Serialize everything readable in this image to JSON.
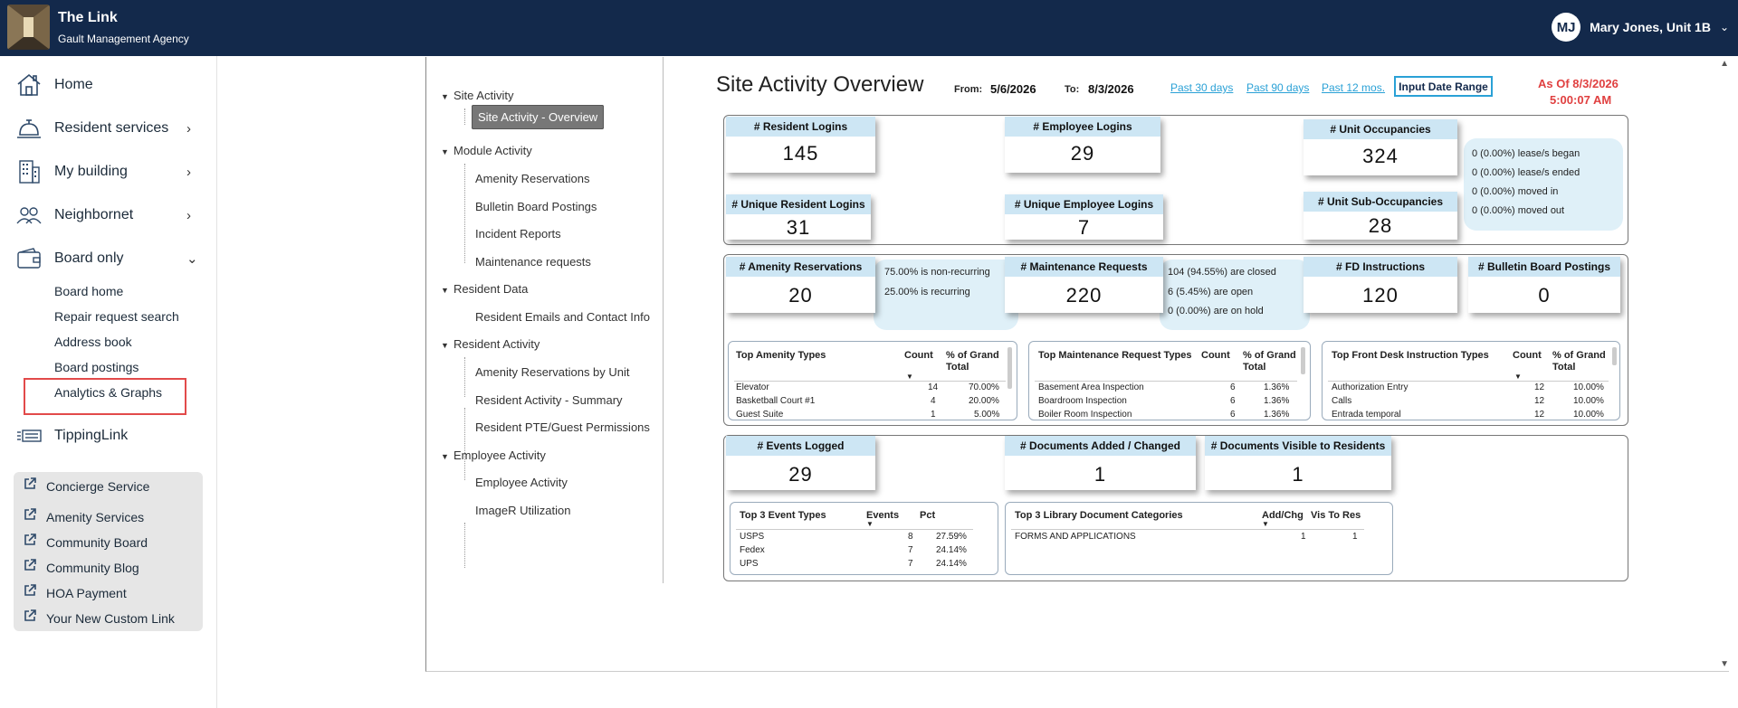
{
  "header": {
    "app_title": "The Link",
    "app_subtitle": "Gault Management Agency",
    "user_initials": "MJ",
    "user_name": "Mary Jones, Unit 1B"
  },
  "sidebar": {
    "items": [
      {
        "label": "Home",
        "icon": "home-icon"
      },
      {
        "label": "Resident services",
        "icon": "bell-icon"
      },
      {
        "label": "My building",
        "icon": "building-icon"
      },
      {
        "label": "Neighbornet",
        "icon": "people-icon"
      },
      {
        "label": "Board only",
        "icon": "wallet-icon"
      },
      {
        "label": "TippingLink",
        "icon": "list-icon"
      }
    ],
    "board_sub": [
      "Board home",
      "Repair request search",
      "Address book",
      "Board postings",
      "Analytics & Graphs"
    ],
    "external_links": [
      "Concierge Service",
      "Amenity Services",
      "Community Board",
      "Community Blog",
      "HOA Payment",
      "Your New Custom Link"
    ]
  },
  "tree": {
    "categories": [
      {
        "label": "Site Activity",
        "items": [
          "Site Activity - Overview"
        ]
      },
      {
        "label": "Module Activity",
        "items": [
          "Amenity Reservations",
          "Bulletin Board Postings",
          "Incident Reports",
          "Maintenance requests"
        ]
      },
      {
        "label": "Resident Data",
        "items": [
          "Resident Emails and Contact Info"
        ]
      },
      {
        "label": "Resident Activity",
        "items": [
          "Amenity Reservations by Unit",
          "Resident Activity - Summary",
          "Resident PTE/Guest Permissions"
        ]
      },
      {
        "label": "Employee Activity",
        "items": [
          "Employee Activity",
          "ImageR Utilization"
        ]
      }
    ]
  },
  "dashboard": {
    "title": "Site Activity Overview",
    "from_label": "From:",
    "from_value": "5/6/2026",
    "to_label": "To:",
    "to_value": "8/3/2026",
    "links": [
      "Past 30 days",
      "Past 90 days",
      "Past 12 mos."
    ],
    "input_range": "Input Date Range",
    "as_of_date": "As Of 8/3/2026",
    "as_of_time": "5:00:07 AM",
    "kpis": {
      "resident_logins": {
        "label": "# Resident Logins",
        "value": "145"
      },
      "employee_logins": {
        "label": "# Employee Logins",
        "value": "29"
      },
      "unit_occupancies": {
        "label": "# Unit Occupancies",
        "value": "324"
      },
      "unique_resident_logins": {
        "label": "# Unique Resident Logins",
        "value": "31"
      },
      "unique_employee_logins": {
        "label": "# Unique Employee Logins",
        "value": "7"
      },
      "unit_sub_occupancies": {
        "label": "# Unit Sub-Occupancies",
        "value": "28"
      },
      "amenity_reservations": {
        "label": "# Amenity Reservations",
        "value": "20"
      },
      "maintenance_requests": {
        "label": "# Maintenance Requests",
        "value": "220"
      },
      "fd_instructions": {
        "label": "# FD Instructions",
        "value": "120"
      },
      "bulletin_board_postings": {
        "label": "# Bulletin Board Postings",
        "value": "0"
      },
      "events_logged": {
        "label": "# Events Logged",
        "value": "29"
      },
      "documents_added": {
        "label": "# Documents Added / Changed",
        "value": "1"
      },
      "documents_visible": {
        "label": "# Documents Visible to Residents",
        "value": "1"
      }
    },
    "occupancy_notes": [
      "0 (0.00%) lease/s began",
      "0 (0.00%) lease/s ended",
      "0 (0.00%) moved in",
      "0 (0.00%) moved out"
    ],
    "amenity_notes": [
      "75.00% is non-recurring",
      "25.00% is recurring"
    ],
    "maintenance_notes": [
      "104 (94.55%) are closed",
      "6 (5.45%) are open",
      "0 (0.00%) are on hold"
    ],
    "tables": {
      "amenity_types": {
        "headers": [
          "Top Amenity Types",
          "Count",
          "% of Grand Total"
        ],
        "rows": [
          [
            "Elevator",
            "14",
            "70.00%"
          ],
          [
            "Basketball Court #1",
            "4",
            "20.00%"
          ],
          [
            "Guest Suite",
            "1",
            "5.00%"
          ]
        ]
      },
      "maintenance_types": {
        "headers": [
          "Top Maintenance Request Types",
          "Count",
          "% of Grand Total"
        ],
        "rows": [
          [
            "Basement Area Inspection",
            "6",
            "1.36%"
          ],
          [
            "Boardroom Inspection",
            "6",
            "1.36%"
          ],
          [
            "Boiler Room Inspection",
            "6",
            "1.36%"
          ]
        ]
      },
      "fd_types": {
        "headers": [
          "Top Front Desk Instruction Types",
          "Count",
          "% of Grand Total"
        ],
        "rows": [
          [
            "Authorization Entry",
            "12",
            "10.00%"
          ],
          [
            "Calls",
            "12",
            "10.00%"
          ],
          [
            "Entrada temporal",
            "12",
            "10.00%"
          ]
        ]
      },
      "event_types": {
        "headers": [
          "Top 3 Event Types",
          "Events",
          "Pct"
        ],
        "rows": [
          [
            "USPS",
            "8",
            "27.59%"
          ],
          [
            "Fedex",
            "7",
            "24.14%"
          ],
          [
            "UPS",
            "7",
            "24.14%"
          ]
        ]
      },
      "doc_categories": {
        "headers": [
          "Top 3 Library Document Categories",
          "Add/Chg",
          "Vis To Res"
        ],
        "rows": [
          [
            "FORMS AND APPLICATIONS",
            "1",
            "1"
          ]
        ]
      }
    }
  },
  "colors": {
    "topbar": "#13294b",
    "kpi_header": "#cde6f4",
    "link": "#2aa1d6",
    "as_of": "#e04040",
    "highlight": "#e24a4a"
  }
}
